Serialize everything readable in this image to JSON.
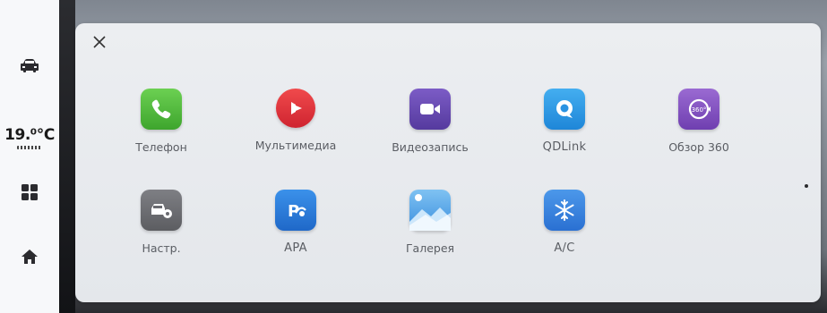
{
  "sidebar": {
    "items": [
      {
        "name": "car",
        "icon": "car-icon"
      },
      {
        "name": "temperature",
        "value": "19.⁰℃"
      },
      {
        "name": "apps",
        "icon": "grid-icon"
      },
      {
        "name": "home",
        "icon": "home-icon"
      }
    ],
    "temperature_text": "19.⁰℃"
  },
  "panel": {
    "close_icon": "close-icon",
    "apps": [
      {
        "label": "Телефон",
        "icon": "phone-icon",
        "color": "#4fb83a"
      },
      {
        "label": "Мультимедиа",
        "icon": "multimedia-icon",
        "color": "#e8363c"
      },
      {
        "label": "Видеозапись",
        "icon": "video-recorder-icon",
        "color": "#6a4bb3"
      },
      {
        "label": "QDLink",
        "icon": "qdlink-icon",
        "color": "#2f9be6"
      },
      {
        "label": "Обзор 360",
        "icon": "view-360-icon",
        "color": "#8a58c4"
      },
      {
        "label": "Настр.",
        "icon": "settings-car-icon",
        "color": "#6f7074"
      },
      {
        "label": "APA",
        "icon": "apa-parking-icon",
        "color": "#2f7fdb"
      },
      {
        "label": "Галерея",
        "icon": "gallery-icon",
        "color": "#3c8fe0"
      },
      {
        "label": "A/C",
        "icon": "ac-snowflake-icon",
        "color": "#3a87e0"
      }
    ]
  }
}
